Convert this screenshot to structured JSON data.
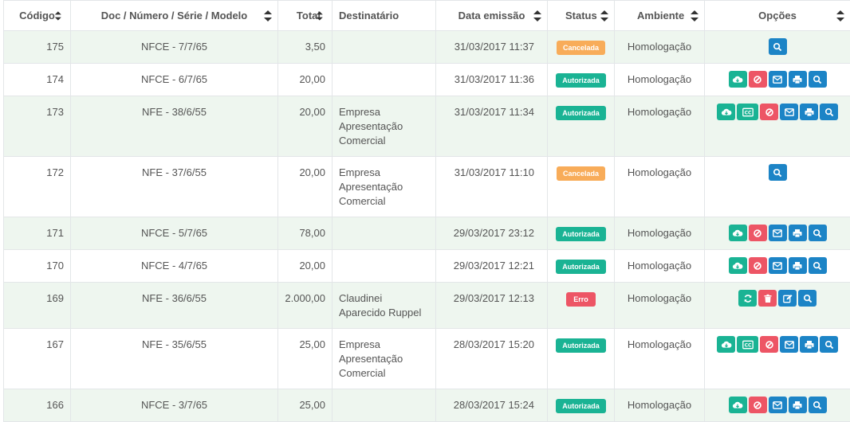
{
  "headers": {
    "codigo": "Código",
    "doc": "Doc / Número / Série / Modelo",
    "total": "Total",
    "destinatario": "Destinatário",
    "data": "Data emissão",
    "status": "Status",
    "ambiente": "Ambiente",
    "opcoes": "Opções"
  },
  "colors": {
    "autorizada": "#1ab394",
    "cancelada": "#f8ac59",
    "erro": "#ed5565",
    "action_blue": "#1c84c6",
    "row_stripe": "#eef6ef"
  },
  "rows": [
    {
      "codigo": "175",
      "doc": "NFCE - 7/7/65",
      "total": "3,50",
      "dest": "",
      "data": "31/03/2017 11:37",
      "status": "Cancelada",
      "status_type": "cancelada",
      "ambiente": "Homologação",
      "actions": [
        "search-icon"
      ]
    },
    {
      "codigo": "174",
      "doc": "NFCE - 6/7/65",
      "total": "20,00",
      "dest": "",
      "data": "31/03/2017 11:36",
      "status": "Autorizada",
      "status_type": "autorizada",
      "ambiente": "Homologação",
      "actions": [
        "cloud-download-icon",
        "ban-icon",
        "envelope-icon",
        "print-icon",
        "search-icon"
      ]
    },
    {
      "codigo": "173",
      "doc": "NFE - 38/6/55",
      "total": "20,00",
      "dest": "Empresa Apresentação Comercial",
      "data": "31/03/2017 11:34",
      "status": "Autorizada",
      "status_type": "autorizada",
      "ambiente": "Homologação",
      "actions": [
        "cloud-download-icon",
        "cc-icon",
        "ban-icon",
        "envelope-icon",
        "print-icon",
        "search-icon"
      ]
    },
    {
      "codigo": "172",
      "doc": "NFE - 37/6/55",
      "total": "20,00",
      "dest": "Empresa Apresentação Comercial",
      "data": "31/03/2017 11:10",
      "status": "Cancelada",
      "status_type": "cancelada",
      "ambiente": "Homologação",
      "actions": [
        "search-icon"
      ]
    },
    {
      "codigo": "171",
      "doc": "NFCE - 5/7/65",
      "total": "78,00",
      "dest": "",
      "data": "29/03/2017 23:12",
      "status": "Autorizada",
      "status_type": "autorizada",
      "ambiente": "Homologação",
      "actions": [
        "cloud-download-icon",
        "ban-icon",
        "envelope-icon",
        "print-icon",
        "search-icon"
      ]
    },
    {
      "codigo": "170",
      "doc": "NFCE - 4/7/65",
      "total": "20,00",
      "dest": "",
      "data": "29/03/2017 12:21",
      "status": "Autorizada",
      "status_type": "autorizada",
      "ambiente": "Homologação",
      "actions": [
        "cloud-download-icon",
        "ban-icon",
        "envelope-icon",
        "print-icon",
        "search-icon"
      ]
    },
    {
      "codigo": "169",
      "doc": "NFE - 36/6/55",
      "total": "2.000,00",
      "dest": "Claudinei Aparecido Ruppel",
      "data": "29/03/2017 12:13",
      "status": "Erro",
      "status_type": "erro",
      "ambiente": "Homologação",
      "actions": [
        "refresh-icon",
        "trash-icon",
        "edit-icon",
        "search-icon"
      ]
    },
    {
      "codigo": "167",
      "doc": "NFE - 35/6/55",
      "total": "25,00",
      "dest": "Empresa Apresentação Comercial",
      "data": "28/03/2017 15:20",
      "status": "Autorizada",
      "status_type": "autorizada",
      "ambiente": "Homologação",
      "actions": [
        "cloud-download-icon",
        "cc-icon",
        "ban-icon",
        "envelope-icon",
        "print-icon",
        "search-icon"
      ]
    },
    {
      "codigo": "166",
      "doc": "NFCE - 3/7/65",
      "total": "25,00",
      "dest": "",
      "data": "28/03/2017 15:24",
      "status": "Autorizada",
      "status_type": "autorizada",
      "ambiente": "Homologação",
      "actions": [
        "cloud-download-icon",
        "ban-icon",
        "envelope-icon",
        "print-icon",
        "search-icon"
      ]
    }
  ]
}
